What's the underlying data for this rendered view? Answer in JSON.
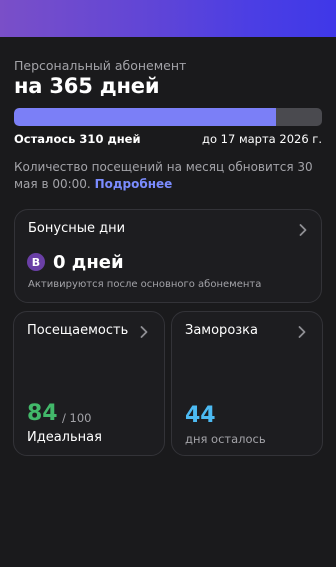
{
  "header": {
    "subtitle": "Персональный абонемент",
    "title": "на 365 дней"
  },
  "progress": {
    "fraction": 0.85,
    "left_label": "Осталось 310 дней",
    "until_label": "до 17 марта 2026 г."
  },
  "notice": {
    "text": "Количество посещений на месяц обновится 30 мая в 00:00.",
    "link": "Подробнее"
  },
  "bonus_card": {
    "title": "Бонусные дни",
    "badge": "B",
    "value": "0 дней",
    "note": "Активируются после основного абонемента",
    "icon": "chevron-right-icon"
  },
  "attendance_card": {
    "title": "Посещаемость",
    "value": "84",
    "total": "/ 100",
    "status": "Идеальная",
    "icon": "chevron-right-icon"
  },
  "freeze_card": {
    "title": "Заморозка",
    "value": "44",
    "label": "дня осталось",
    "icon": "chevron-right-icon"
  },
  "colors": {
    "accent": "#7b7ff7",
    "attendance": "#42b86a",
    "freeze": "#4cbaf2",
    "link": "#7b8cff",
    "badge": "#6a3fa6"
  }
}
